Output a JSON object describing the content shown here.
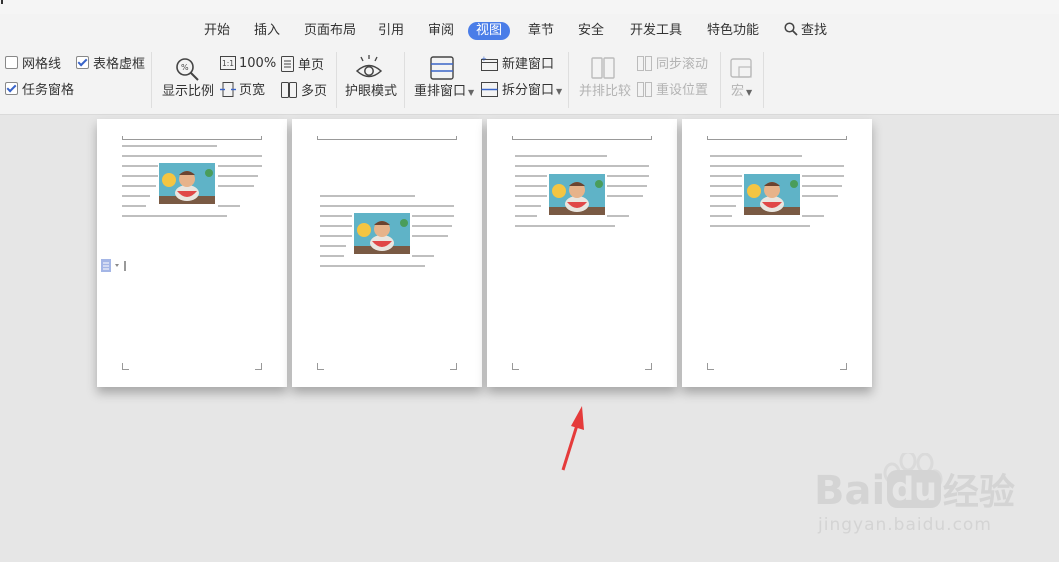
{
  "menu": {
    "tabs": [
      "开始",
      "插入",
      "页面布局",
      "引用",
      "审阅",
      "视图",
      "章节",
      "安全",
      "开发工具",
      "特色功能",
      "查找"
    ],
    "active_tab": "视图"
  },
  "ribbon": {
    "gridlines": {
      "label": "网格线",
      "checked": false
    },
    "table_gridlines": {
      "label": "表格虚框",
      "checked": true
    },
    "task_pane": {
      "label": "任务窗格",
      "checked": true
    },
    "zoom": "显示比例",
    "hundred": "100%",
    "page_width": "页宽",
    "single_page": "单页",
    "multi_page": "多页",
    "eye_mode": "护眼模式",
    "arrange_window": "重排窗口",
    "new_window": "新建窗口",
    "split_window": "拆分窗口",
    "side_by_side": "并排比较",
    "sync_scroll": "同步滚动",
    "reset_position": "重设位置",
    "macro": "宏"
  },
  "watermark": {
    "brand": "Bai",
    "brand_du": "du",
    "product": "经验",
    "url": "jingyan.baidu.com"
  },
  "colors": {
    "accent": "#4a7de8",
    "arrow": "#e53b3b",
    "canvas": "#e6e6e6",
    "ribbon": "#f3f3f3"
  }
}
